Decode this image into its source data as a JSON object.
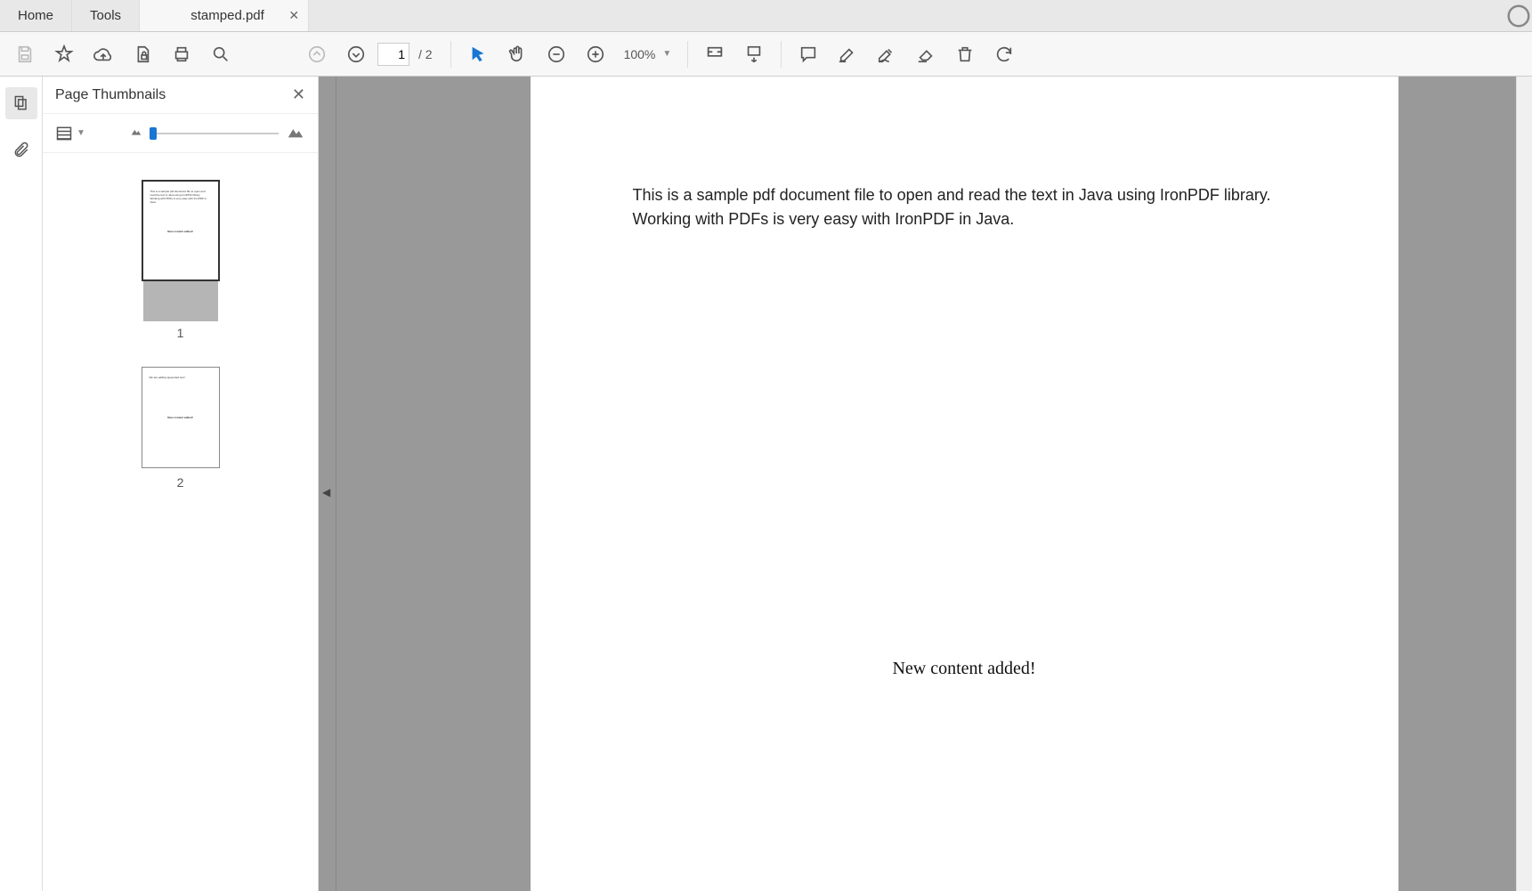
{
  "tabs": {
    "home": "Home",
    "tools": "Tools",
    "doc": "stamped.pdf"
  },
  "toolbar": {
    "page_current": "1",
    "page_total": "/ 2",
    "zoom": "100%"
  },
  "panel": {
    "title": "Page Thumbnails",
    "thumbs": [
      {
        "num": "1"
      },
      {
        "num": "2"
      }
    ]
  },
  "document": {
    "paragraph": "This is a sample pdf document file to open and read the text in Java using IronPDF library. Working with PDFs is very easy with IronPDF in Java.",
    "stamp": "New content added!"
  }
}
